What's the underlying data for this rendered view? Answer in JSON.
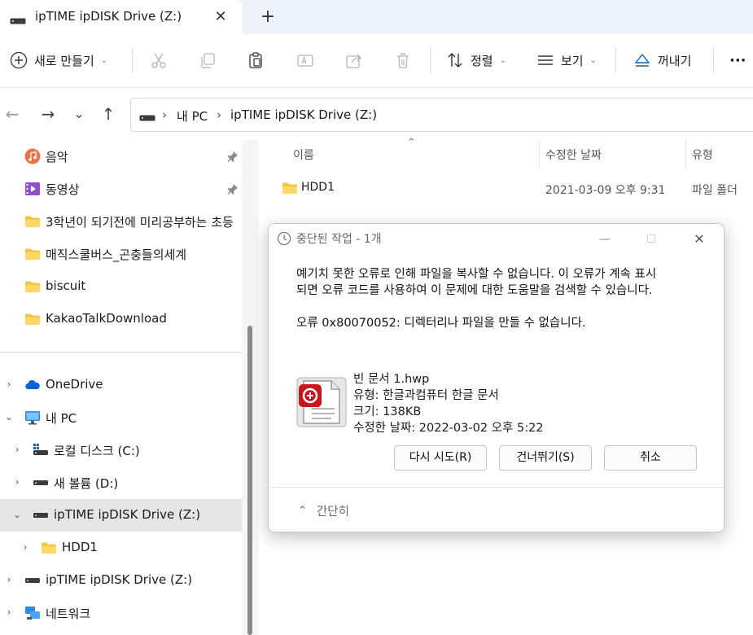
{
  "tab": {
    "title": "ipTIME ipDISK Drive (Z:)",
    "close": "✕",
    "new_tab": "+"
  },
  "toolbar": {
    "new_label": "새로 만들기",
    "sort_label": "정렬",
    "view_label": "보기",
    "eject_label": "꺼내기",
    "more_label": "···",
    "chevron": "⌄"
  },
  "nav": {
    "back": "←",
    "forward": "→",
    "recent": "⌄",
    "up": "↑",
    "sep": "›",
    "crumbs": [
      "내 PC",
      "ipTIME ipDISK Drive (Z:)"
    ]
  },
  "sidebar": {
    "expand": "›",
    "collapse": "⌄",
    "items": [
      {
        "label": "음악"
      },
      {
        "label": "동영상"
      },
      {
        "label": "3학년이 되기전에 미리공부하는 초등"
      },
      {
        "label": "매직스쿨버스_곤충들의세계"
      },
      {
        "label": "biscuit"
      },
      {
        "label": "KakaoTalkDownload"
      },
      {
        "label": "OneDrive"
      },
      {
        "label": "내 PC"
      },
      {
        "label": "로컬 디스크 (C:)"
      },
      {
        "label": "새 볼륨 (D:)"
      },
      {
        "label": "ipTIME ipDISK Drive (Z:)"
      },
      {
        "label": "HDD1"
      },
      {
        "label": "ipTIME ipDISK Drive (Z:)"
      },
      {
        "label": "네트워크"
      }
    ]
  },
  "content": {
    "sort_arrow": "⌃",
    "columns": {
      "name": "이름",
      "modified": "수정한 날짜",
      "type": "유형"
    },
    "files": [
      {
        "name": "HDD1",
        "modified": "2021-03-09 오후 9:31",
        "type": "파일 폴더"
      }
    ]
  },
  "dialog": {
    "title": "중단된 작업 - 1개",
    "min": "—",
    "max": "☐",
    "close": "✕",
    "message_line1": "예기치 못한 오류로 인해 파일을 복사할 수 없습니다. 이 오류가 계속 표시",
    "message_line2": "되면 오류 코드를 사용하여 이 문제에 대한 도움말을 검색할 수 있습니다.",
    "error": "오류 0x80070052: 디렉터리나 파일을 만들 수 없습니다.",
    "file": {
      "name": "빈 문서 1.hwp",
      "type": "유형: 한글과컴퓨터 한글 문서",
      "size": "크기: 138KB",
      "modified": "수정한 날짜: 2022-03-02 오후 5:22"
    },
    "buttons": {
      "retry": "다시 시도(R)",
      "skip": "건너뛰기(S)",
      "cancel": "취소"
    },
    "less_details": "간단히",
    "less_chevron": "⌃"
  },
  "colors": {
    "accent": "#0067c0",
    "folder": "#f6c343",
    "selected": "#e5e5e5",
    "hwp_red": "#c4161c"
  }
}
